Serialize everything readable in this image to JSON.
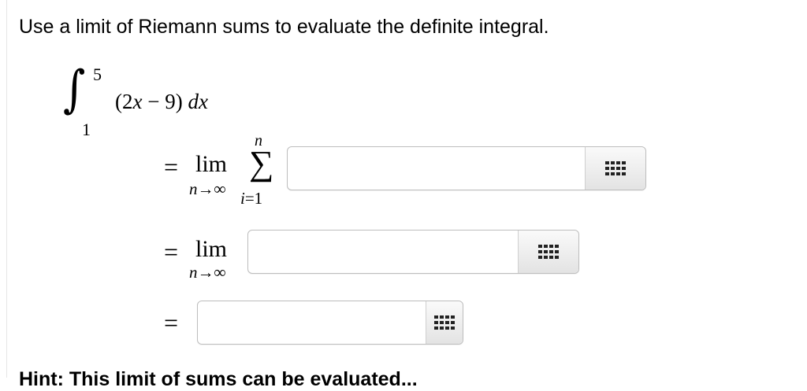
{
  "question": {
    "prompt": "Use a limit of Riemann sums to evaluate the definite integral.",
    "integral": {
      "sign": "∫",
      "upper": "5",
      "lower": "1",
      "integrand": "(2x − 9) dx"
    }
  },
  "steps": {
    "equals": "=",
    "lim": "lim",
    "lim_sub": "n→∞",
    "sum_sign": "∑",
    "sum_upper": "n",
    "sum_lower": "i=1"
  },
  "inputs": [
    {
      "value": "",
      "placeholder": "",
      "keypad_icon": "keypad-grid-icon"
    },
    {
      "value": "",
      "placeholder": "",
      "keypad_icon": "keypad-grid-icon"
    },
    {
      "value": "",
      "placeholder": "",
      "keypad_icon": "keypad-grid-icon"
    }
  ],
  "hint_partial": "Hint: This limit of sums can be evaluated..."
}
